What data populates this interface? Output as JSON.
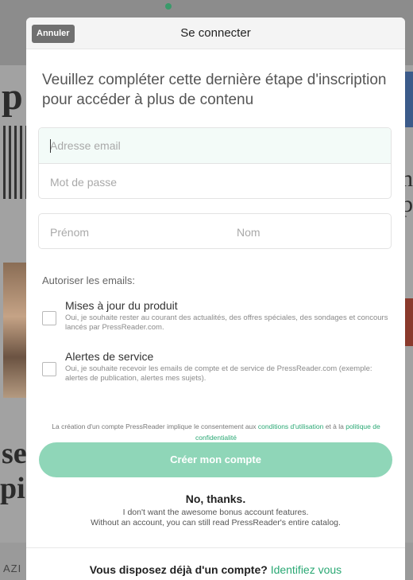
{
  "header": {
    "cancel_label": "Annuler",
    "title": "Se connecter"
  },
  "intro_text": "Veuillez compléter cette dernière étape d'inscription pour accéder à plus de contenu",
  "form": {
    "email_placeholder": "Adresse email",
    "password_placeholder": "Mot de passe",
    "first_name_placeholder": "Prénom",
    "last_name_placeholder": "Nom"
  },
  "emails": {
    "section_label": "Autoriser les emails:",
    "options": [
      {
        "title": "Mises à jour du produit",
        "description": "Oui, je souhaite rester au courant des actualités, des offres spéciales, des sondages et concours lancés par PressReader.com.",
        "checked": false
      },
      {
        "title": "Alertes de service",
        "description": "Oui, je souhaite recevoir les emails de compte et de service de PressReader.com (exemple: alertes de publication, alertes mes sujets).",
        "checked": false
      }
    ]
  },
  "consent": {
    "prefix": "La création d'un compte PressReader implique le consentement aux ",
    "terms_link": "conditions d'utilisation",
    "middle": " et à la ",
    "privacy_link": "politique de confidentialité"
  },
  "create_button_label": "Créer mon compte",
  "no_thanks": {
    "title": "No, thanks.",
    "line1": "I don't want the awesome bonus account features.",
    "line2": "Without an account, you can still read PressReader's entire catalog."
  },
  "footer": {
    "question": "Vous disposez déjà d'un compte?",
    "link": "Identifiez vous"
  },
  "colors": {
    "accent": "#2aa874",
    "button": "#8fd6b8",
    "cancel_button": "#707070"
  }
}
